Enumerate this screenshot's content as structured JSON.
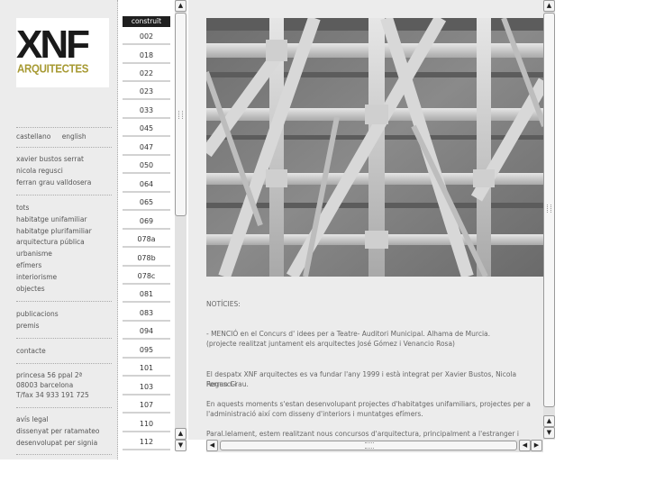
{
  "logo": {
    "big": "XNF",
    "small": "ARQUITECTES"
  },
  "sidebar": {
    "languages": [
      "castellano",
      "english"
    ],
    "people": [
      "xavier bustos serrat",
      "nicola regusci",
      "ferran grau valldosera"
    ],
    "categories": [
      "tots",
      "habitatge unifamiliar",
      "habitatge plurifamiliar",
      "arquitectura pública",
      "urbanisme",
      "efímers",
      "interiorisme",
      "objectes"
    ],
    "publications": [
      "publicacions",
      "premis"
    ],
    "contact": "contacte",
    "address": [
      "princesa 56 ppal 2ª",
      "08003 barcelona",
      "T/fax 34 933 191 725"
    ],
    "footer": [
      "avís legal",
      "dissenyat per ratamateo",
      "desenvolupat per signia"
    ]
  },
  "numbers": {
    "heading": "construït",
    "items": [
      "002",
      "018",
      "022",
      "023",
      "033",
      "045",
      "047",
      "050",
      "064",
      "065",
      "069",
      "078a",
      "078b",
      "078c",
      "081",
      "083",
      "094",
      "095",
      "101",
      "103",
      "107",
      "110",
      "112"
    ]
  },
  "scrollbar": {
    "up": "▲",
    "down": "▼",
    "left": "◀",
    "right": "▶"
  },
  "content": {
    "news_title": "NOTÍCIES:",
    "p1a": "- MENCIÓ en el Concurs d' idees per a Teatre- Auditori Municipal. Alhama de Murcia.",
    "p1b": "(projecte realitzat juntament els arquitectes José Gómez i Venancio Rosa)",
    "p2a": "El despatx XNF arquitectes es va fundar l'any 1999 i està integrat per Xavier Bustos, Nicola Regusci i",
    "p2b": "Ferran Grau.",
    "p3a": "En aquests moments s'estan desenvolupant projectes d'habitatges unifamiliars, projectes per a",
    "p3b": "l'administració així com disseny d'interiors i muntatges efímers.",
    "p4a": "Paral.lelament, estem realitzant nous concursos d'arquitectura, principalment a l'estranger i dissenyant"
  },
  "colors": {
    "sidebar_bg": "#ececec",
    "logo_accent": "#a79a33",
    "heading_bg": "#1f1f1f"
  }
}
